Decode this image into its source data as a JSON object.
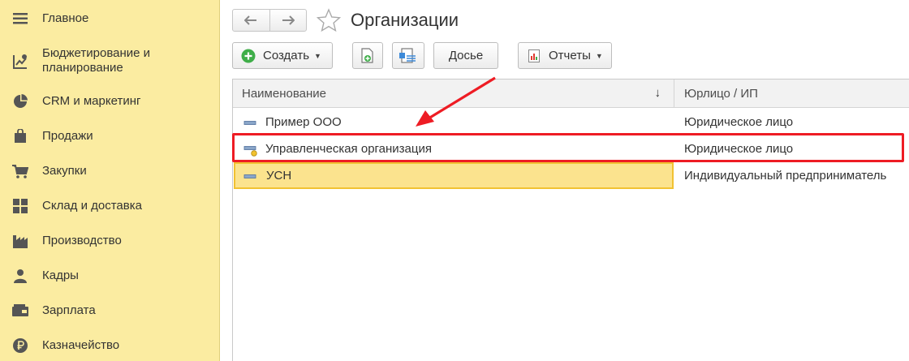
{
  "sidebar": {
    "items": [
      {
        "label": "Главное",
        "icon": "menu-lines-icon"
      },
      {
        "label": "Бюджетирование и планирование",
        "icon": "budget-chart-icon"
      },
      {
        "label": "CRM и маркетинг",
        "icon": "pie-chart-icon"
      },
      {
        "label": "Продажи",
        "icon": "shopping-bag-icon"
      },
      {
        "label": "Закупки",
        "icon": "cart-icon"
      },
      {
        "label": "Склад и доставка",
        "icon": "warehouse-icon"
      },
      {
        "label": "Производство",
        "icon": "factory-icon"
      },
      {
        "label": "Кадры",
        "icon": "person-icon"
      },
      {
        "label": "Зарплата",
        "icon": "wallet-icon"
      },
      {
        "label": "Казначейство",
        "icon": "ruble-coin-icon"
      }
    ]
  },
  "header": {
    "title": "Организации"
  },
  "toolbar": {
    "create_label": "Создать",
    "dossier_label": "Досье",
    "reports_label": "Отчеты"
  },
  "table": {
    "columns": [
      "Наименование",
      "Юрлицо / ИП"
    ],
    "sort_indicator": "↓",
    "rows": [
      {
        "name": "Пример ООО",
        "type": "Юридическое лицо",
        "icon": "org-dash-icon"
      },
      {
        "name": "Управленческая организация",
        "type": "Юридическое лицо",
        "icon": "org-dash-dot-icon"
      },
      {
        "name": "УСН",
        "type": "Индивидуальный предприниматель",
        "icon": "org-dash-icon"
      }
    ]
  },
  "colors": {
    "sidebar_bg": "#fbeca1",
    "selected_row": "#fbe38e",
    "annotation_red": "#ee1c24",
    "create_green": "#3fae49"
  }
}
